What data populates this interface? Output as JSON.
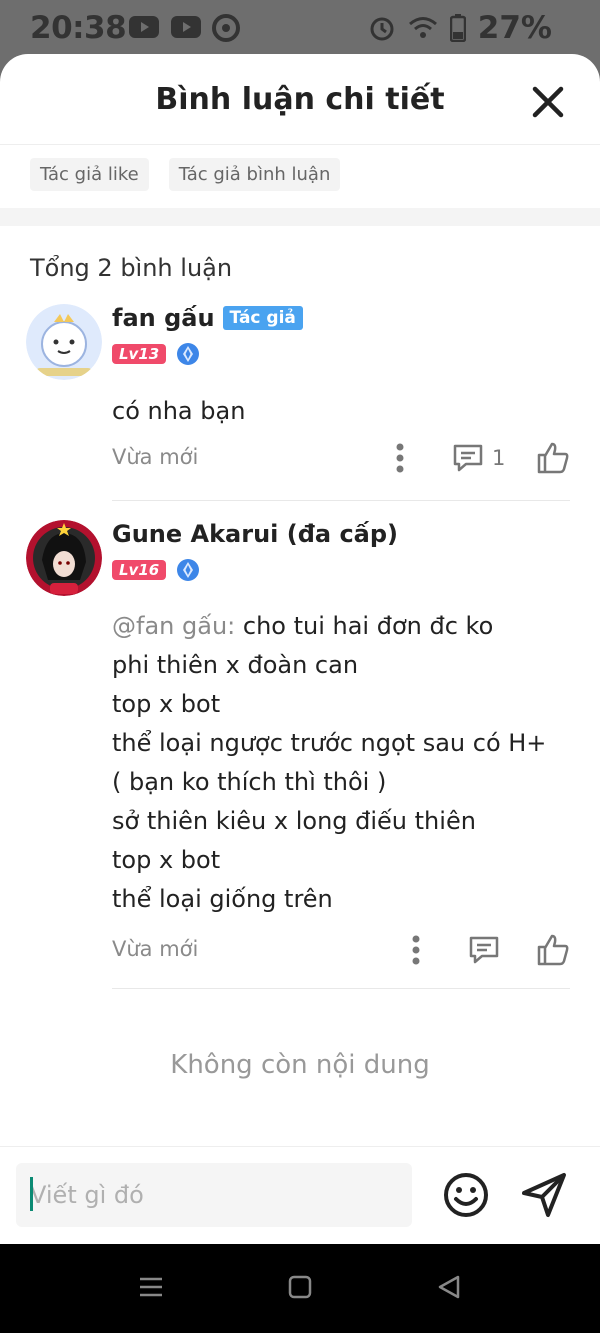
{
  "status_bar": {
    "time": "20:38",
    "battery": "27%",
    "notification_icons": [
      "youtube-icon",
      "youtube-icon",
      "chrome-icon"
    ],
    "system_icons": [
      "alarm-icon",
      "wifi-icon",
      "battery-icon"
    ]
  },
  "sheet": {
    "title": "Bình luận chi tiết",
    "filters": [
      "Tác giả like",
      "Tác giả bình luận"
    ],
    "total": "Tổng 2 bình luận"
  },
  "comments": [
    {
      "name": "fan gấu",
      "author_tag": "Tác giả",
      "level": "Lv13",
      "text": "có nha bạn",
      "time": "Vừa mới",
      "reply_count": "1"
    },
    {
      "name": "Gune Akarui (đa cấp)",
      "level": "Lv16",
      "mention": "@fan gấu:",
      "lines": [
        "cho tui hai đơn đc ko",
        "phi thiên x đoàn can",
        "top x bot",
        "thể loại ngược trước ngọt sau có H+",
        "( bạn ko thích thì thôi )",
        "sở thiên kiêu x long điếu thiên",
        "top x bot",
        "thể loại giống trên"
      ],
      "time": "Vừa mới"
    }
  ],
  "end_text": "Không còn nội dung",
  "composer": {
    "placeholder": "Viết gì đó"
  },
  "colors": {
    "level_badge": "#f04a6a",
    "author_tag": "#4aa3f0",
    "caret": "#0b8a73"
  }
}
